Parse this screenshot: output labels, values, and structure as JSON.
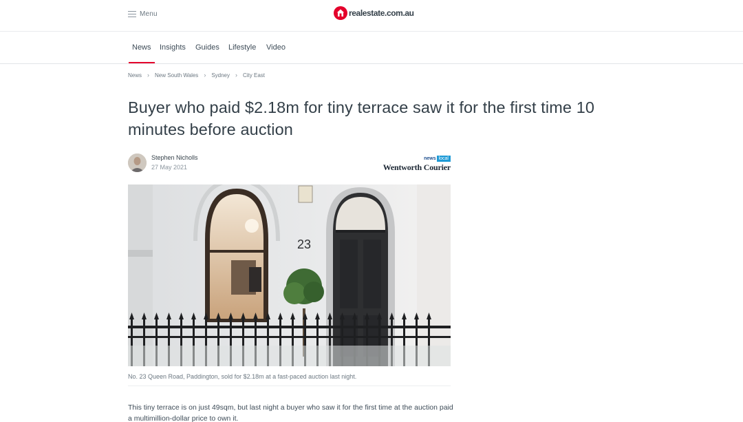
{
  "header": {
    "menu_label": "Menu",
    "logo_text": "realestate.com.au",
    "brand_color": "#e4002b"
  },
  "nav": {
    "items": [
      {
        "label": "News",
        "active": true
      },
      {
        "label": "Insights"
      },
      {
        "label": "Guides"
      },
      {
        "label": "Lifestyle"
      },
      {
        "label": "Video"
      }
    ]
  },
  "breadcrumb": [
    "News",
    "New South Wales",
    "Sydney",
    "City East"
  ],
  "article": {
    "title": "Buyer who paid $2.18m for tiny terrace saw it for the first time 10 minutes before auction",
    "author": "Stephen Nicholls",
    "date": "27 May 2021",
    "publisher": {
      "top_left": "news",
      "top_right": "local",
      "name": "Wentworth Courier"
    },
    "image": {
      "house_number": "23",
      "icon": "terrace-house-photo"
    },
    "caption": "No. 23 Queen Road, Paddington, sold for $2.18m at a fast-paced auction last night.",
    "body": "This tiny terrace is on just 49sqm, but last night a buyer who saw it for the first time at the auction paid a multimillion-dollar price to own it."
  }
}
